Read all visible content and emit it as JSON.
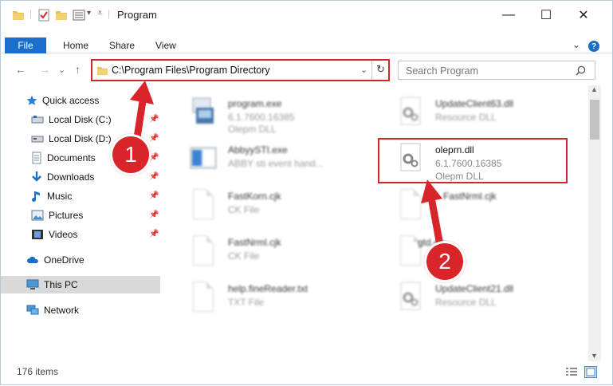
{
  "window": {
    "title": "Program",
    "controls": {
      "minimize": "—",
      "maximize": "☐",
      "close": "✕"
    }
  },
  "ribbon": {
    "tabs": [
      "File",
      "Home",
      "Share",
      "View"
    ],
    "expand": "⌄",
    "help": "?"
  },
  "nav": {
    "back": "←",
    "forward": "→",
    "recent": "⌄",
    "up": "↑",
    "address": "C:\\Program Files\\Program Directory",
    "search_placeholder": "Search Program"
  },
  "sidebar": {
    "items": [
      {
        "label": "Quick access",
        "icon": "star-icon",
        "pinned": false
      },
      {
        "label": "Local Disk (C:)",
        "icon": "drive-icon",
        "pinned": true
      },
      {
        "label": "Local Disk (D:)",
        "icon": "drive-icon",
        "pinned": true
      },
      {
        "label": "Documents",
        "icon": "documents-icon",
        "pinned": true
      },
      {
        "label": "Downloads",
        "icon": "download-icon",
        "pinned": true
      },
      {
        "label": "Music",
        "icon": "music-icon",
        "pinned": true
      },
      {
        "label": "Pictures",
        "icon": "pictures-icon",
        "pinned": true
      },
      {
        "label": "Videos",
        "icon": "videos-icon",
        "pinned": true
      },
      {
        "label": "OneDrive",
        "icon": "cloud-icon",
        "pinned": false
      },
      {
        "label": "This PC",
        "icon": "computer-icon",
        "pinned": false
      },
      {
        "label": "Network",
        "icon": "network-icon",
        "pinned": false
      }
    ]
  },
  "files": [
    {
      "name": "program.exe",
      "detail1": "6.1.7600.16385",
      "detail2": "Olepm DLL",
      "icon": "exe-icon"
    },
    {
      "name": "UpdateClient63.dll",
      "detail1": "Resource DLL",
      "detail2": "",
      "icon": "dll-gear-icon"
    },
    {
      "name": "AbbyySTI.exe",
      "detail1": "ABBY sti event hand...",
      "detail2": "",
      "icon": "app-window-icon"
    },
    {
      "name": "oleprn.dll",
      "detail1": "6.1.7600.16385",
      "detail2": "Olepm DLL",
      "icon": "dll-gear-icon"
    },
    {
      "name": "FastKorn.cjk",
      "detail1": "CK File",
      "detail2": "",
      "icon": "blank-file-icon"
    },
    {
      "name": "FastNrml.cjk",
      "detail1": "",
      "detail2": "",
      "icon": "blank-file-icon"
    },
    {
      "name": "FastNrml.cjk",
      "detail1": "CK File",
      "detail2": "",
      "icon": "blank-file-icon"
    },
    {
      "name": "gtd.dll",
      "detail1": "",
      "detail2": "",
      "icon": "blank-file-icon"
    },
    {
      "name": "help.fineReader.txt",
      "detail1": "TXT File",
      "detail2": "",
      "icon": "txt-file-icon"
    },
    {
      "name": "UpdateClient21.dll",
      "detail1": "Resource DLL",
      "detail2": "",
      "icon": "dll-gear-icon"
    }
  ],
  "status": {
    "count": "176 items"
  },
  "annotations": {
    "step1": "1",
    "step2": "2"
  },
  "colors": {
    "accent": "#1b6fcb",
    "highlight": "#d9252a"
  }
}
